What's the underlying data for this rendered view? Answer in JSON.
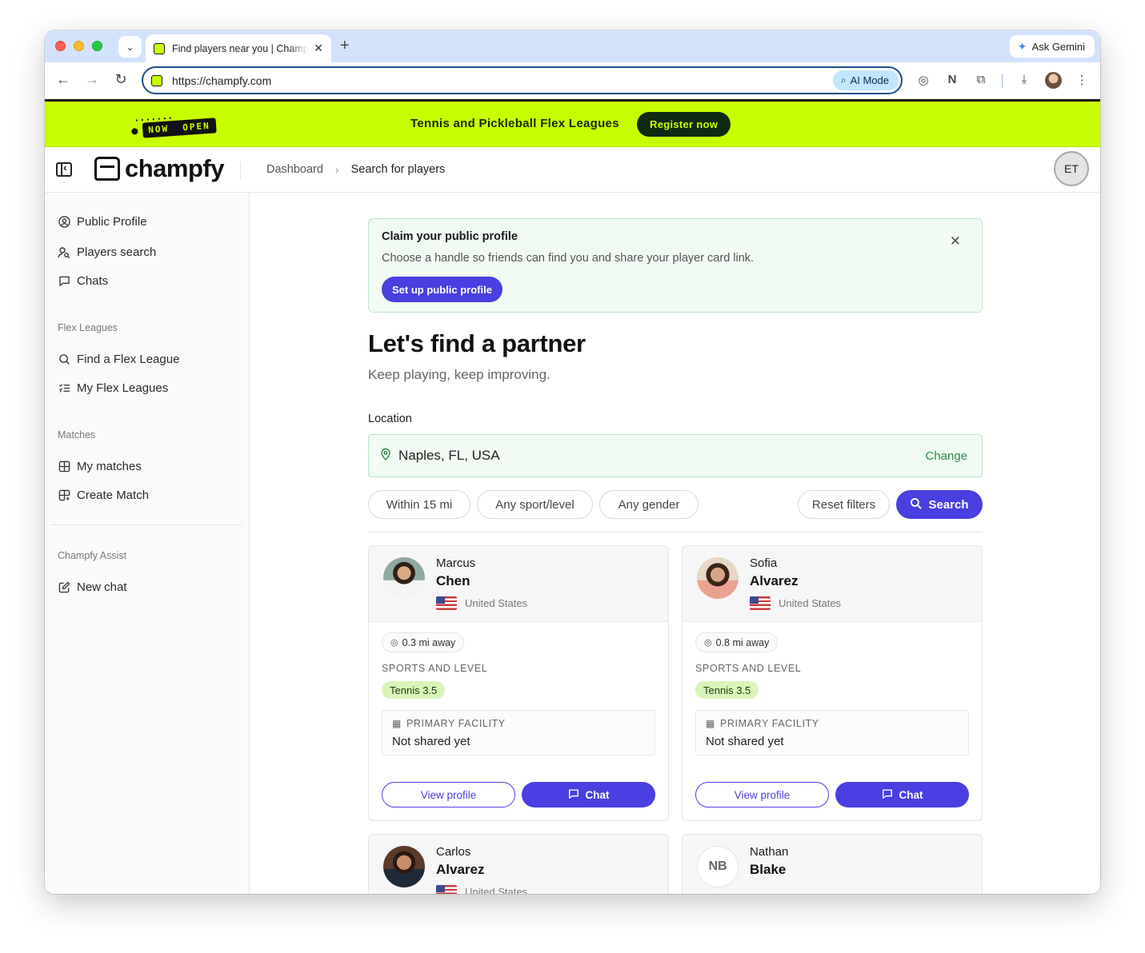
{
  "browser": {
    "tab_title": "Find players near you | Champfy",
    "url": "https://champfy.com",
    "ai_mode_label": "AI Mode",
    "ask_gemini_label": "Ask Gemini"
  },
  "banner": {
    "badge_top": "NOW",
    "badge_bottom": "OPEN",
    "text": "Tennis and Pickleball Flex Leagues",
    "button": "Register now",
    "color": "#c8ff00"
  },
  "header": {
    "logo": "champfy",
    "breadcrumb": [
      "Dashboard",
      "Search for players"
    ],
    "user_initials": "ET"
  },
  "sidebar": {
    "items": [
      {
        "label": "Public Profile",
        "icon": "user-circle-icon"
      },
      {
        "label": "Players search",
        "icon": "user-search-icon"
      },
      {
        "label": "Chats",
        "icon": "chat-icon"
      }
    ],
    "flex_label": "Flex Leagues",
    "flex_items": [
      {
        "label": "Find a Flex League",
        "icon": "search-icon"
      },
      {
        "label": "My Flex Leagues",
        "icon": "list-check-icon"
      }
    ],
    "matches_label": "Matches",
    "matches_items": [
      {
        "label": "My matches",
        "icon": "grid-icon"
      },
      {
        "label": "Create Match",
        "icon": "grid-plus-icon"
      }
    ],
    "assist_label": "Champfy Assist",
    "assist_items": [
      {
        "label": "New chat",
        "icon": "edit-icon"
      }
    ]
  },
  "claim": {
    "title": "Claim your public profile",
    "description": "Choose a handle so friends can find you and share your player card link.",
    "button": "Set up public profile"
  },
  "main": {
    "title": "Let's find a partner",
    "subtitle": "Keep playing, keep improving.",
    "location_label": "Location",
    "location_value": "Naples, FL, USA",
    "change_label": "Change"
  },
  "filters": {
    "distance": "Within 15 mi",
    "sport": "Any sport/level",
    "gender": "Any gender",
    "reset": "Reset filters",
    "search": "Search",
    "accent": "#4a3fe0"
  },
  "players": [
    {
      "first": "Marcus",
      "last": "Chen",
      "country": "United States",
      "distance": "0.3 mi away",
      "sports_label": "SPORTS AND LEVEL",
      "sport": "Tennis 3.5",
      "facility_label": "PRIMARY FACILITY",
      "facility": "Not shared yet",
      "view": "View profile",
      "chat": "Chat"
    },
    {
      "first": "Sofia",
      "last": "Alvarez",
      "country": "United States",
      "distance": "0.8 mi away",
      "sports_label": "SPORTS AND LEVEL",
      "sport": "Tennis 3.5",
      "facility_label": "PRIMARY FACILITY",
      "facility": "Not shared yet",
      "view": "View profile",
      "chat": "Chat"
    },
    {
      "first": "Carlos",
      "last": "Alvarez",
      "country": "United States"
    },
    {
      "first": "Nathan",
      "last": "Blake",
      "initials": "NB"
    }
  ]
}
